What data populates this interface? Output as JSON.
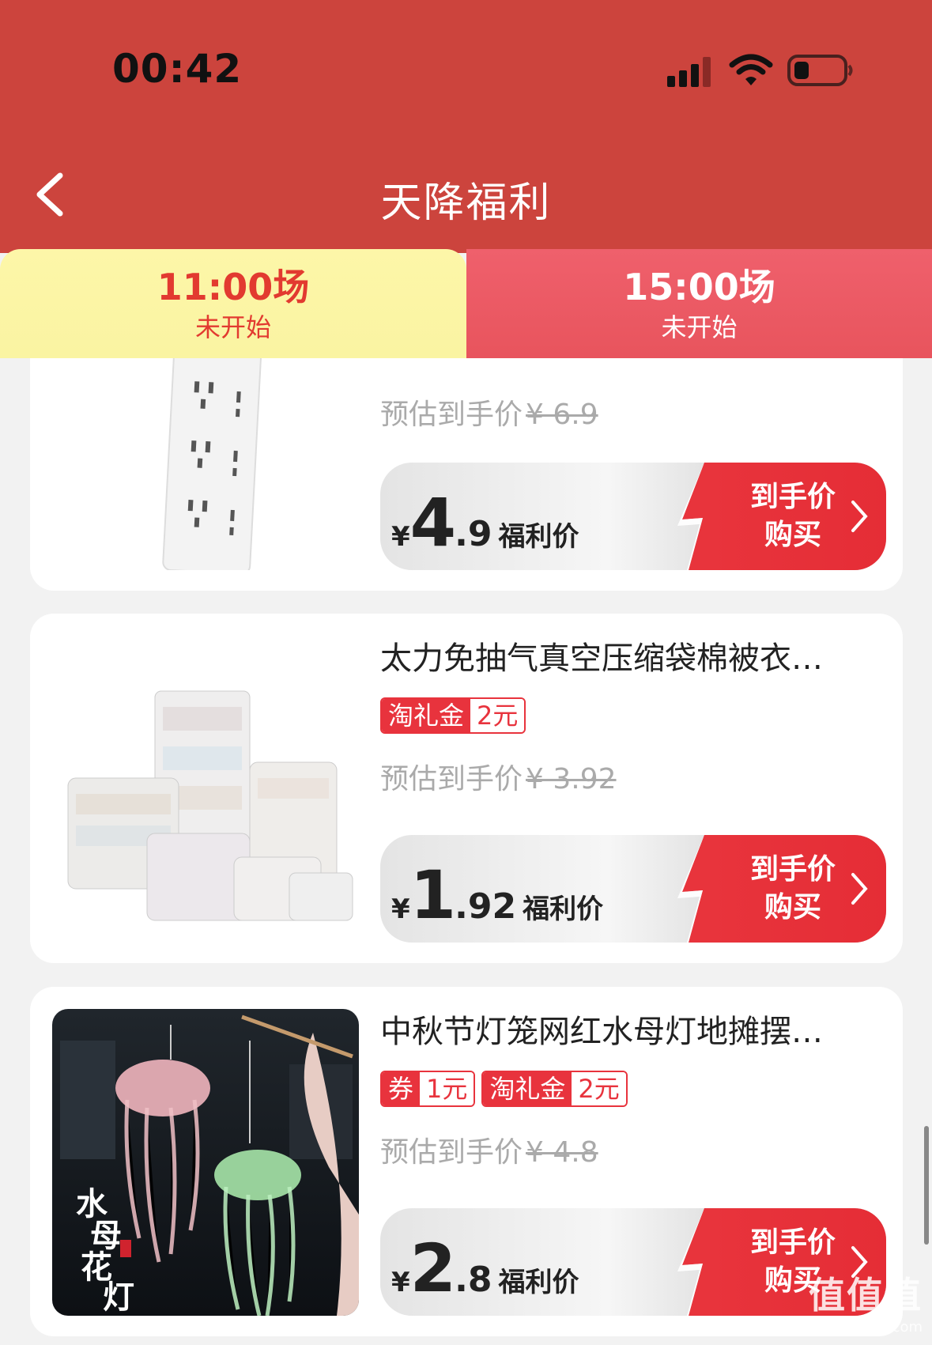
{
  "status_bar": {
    "time": "00:42"
  },
  "nav": {
    "title": "天降福利"
  },
  "tabs": [
    {
      "time": "11:00场",
      "status": "未开始",
      "active": true
    },
    {
      "time": "15:00场",
      "status": "未开始",
      "active": false
    }
  ],
  "products": [
    {
      "title": "",
      "tags": [],
      "estimate_label": "预估到手价",
      "estimate_amount": "¥ 6.9",
      "price_symbol": "¥",
      "price_int": "4",
      "price_dec": ".9",
      "price_label": "福利价",
      "buy_label_1": "到手价",
      "buy_label_2": "购买"
    },
    {
      "title": "太力免抽气真空压缩袋棉被衣…",
      "tags": [
        {
          "k": "淘礼金",
          "v": "2元"
        }
      ],
      "estimate_label": "预估到手价",
      "estimate_amount": "¥ 3.92",
      "price_symbol": "¥",
      "price_int": "1",
      "price_dec": ".92",
      "price_label": "福利价",
      "buy_label_1": "到手价",
      "buy_label_2": "购买"
    },
    {
      "title": "中秋节灯笼网红水母灯地摊摆…",
      "tags": [
        {
          "k": "券",
          "v": "1元"
        },
        {
          "k": "淘礼金",
          "v": "2元"
        }
      ],
      "estimate_label": "预估到手价",
      "estimate_amount": "¥ 4.8",
      "price_symbol": "¥",
      "price_int": "2",
      "price_dec": ".8",
      "price_label": "福利价",
      "buy_label_1": "到手价",
      "buy_label_2": "购买",
      "image_text": "水母花灯"
    }
  ],
  "watermark": {
    "main": "值值值",
    "sub": "zhizhizhi.com"
  },
  "colors": {
    "header": "#cc443d",
    "accent": "#e8333d",
    "tab_active_bg": "#fdf6a8"
  }
}
